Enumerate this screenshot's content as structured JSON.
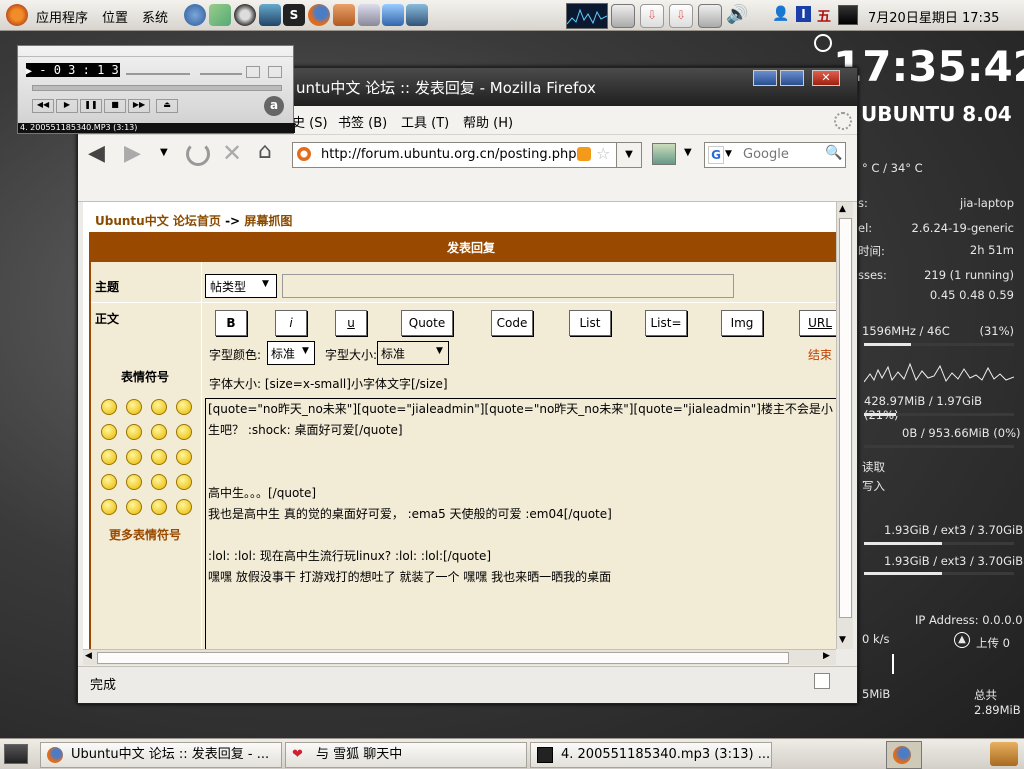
{
  "top_panel": {
    "menus": [
      "应用程序",
      "位置",
      "系统"
    ],
    "input_method": "五",
    "clock": "7月20日星期日 17:35"
  },
  "conky": {
    "time": "17:35:42",
    "distro": "UBUNTU 8.04",
    "temp": "° C / 34° C",
    "rows": [
      {
        "label": "s:",
        "value": "jia-laptop"
      },
      {
        "label": "el:",
        "value": "2.6.24-19-generic"
      },
      {
        "label": "时间:",
        "value": "2h 51m"
      },
      {
        "label": "sses:",
        "value": "219 (1 running)"
      },
      {
        "label": "",
        "value": "0.45 0.48 0.59"
      }
    ],
    "cpu": {
      "label": "1596MHz / 46C",
      "value": "(31%)",
      "percent": 31
    },
    "ram": {
      "label": "428.97MiB / 1.97GiB (21%)",
      "percent": 21
    },
    "swap": {
      "label": "0B / 953.66MiB (0%)",
      "percent": 0
    },
    "disk_read": "读取",
    "disk_write": "写入",
    "fs1": {
      "label": "1.93GiB / ext3 / 3.70GiB",
      "percent": 52
    },
    "fs2": {
      "label": "1.93GiB / ext3 / 3.70GiB",
      "percent": 52
    },
    "ip": "IP Address: 0.0.0.0",
    "down_speed": "0 k/s",
    "up_label": "上传 0",
    "total_down": "5MiB",
    "total_up": "总共2.89MiB"
  },
  "player": {
    "time": "- 0 3 : 1 3",
    "track": "4. 200551185340.MP3 (3:13)"
  },
  "firefox": {
    "title": "untu中文 论坛 :: 发表回复 - Mozilla Firefox",
    "menus": [
      "史 (S)",
      "书签 (B)",
      "工具 (T)",
      "帮助 (H)"
    ],
    "url": "http://forum.ubuntu.org.cn/posting.php",
    "search_placeholder": "Google",
    "status": "完成"
  },
  "page": {
    "breadcrumb_home": "Ubuntu中文 论坛首页",
    "breadcrumb_sep": "->",
    "breadcrumb_current": "屏幕抓图",
    "header": "发表回复",
    "subject_label": "主题",
    "post_type": "帖类型",
    "body_label": "正文",
    "smilies_title": "表情符号",
    "more_smilies": "更多表情符号",
    "buttons": [
      "B",
      "i",
      "u",
      "Quote",
      "Code",
      "List",
      "List=",
      "Img",
      "URL"
    ],
    "font_color_label": "字型颜色:",
    "font_color_value": "标准",
    "font_size_label": "字型大小:",
    "font_size_value": "标准",
    "close_tags": "结束",
    "hint": "字体大小: [size=x-small]小字体文字[/size]",
    "textarea_lines": [
      "[quote=\"no昨天_no未来\"][quote=\"jialeadmin\"][quote=\"no昨天_no未来\"][quote=\"jialeadmin\"]楼主不会是小",
      "生吧？ :shock: 桌面好可爱[/quote]",
      "",
      "",
      "高中生。。。[/quote]",
      "我也是高中生 真的觉的桌面好可爱， :ema5 天使般的可爱 :em04[/quote]",
      "",
      " :lol:  :lol: 现在高中生流行玩linux? :lol:  :lol:[/quote]",
      "嘿嘿 放假没事干 打游戏打的想吐了 就装了一个 嘿嘿 我也来晒一晒我的桌面"
    ]
  },
  "taskbar": {
    "tasks": [
      "Ubuntu中文 论坛 :: 发表回复 - ...",
      "与 雪狐 聊天中",
      "4. 200551185340.mp3 (3:13) ..."
    ]
  }
}
